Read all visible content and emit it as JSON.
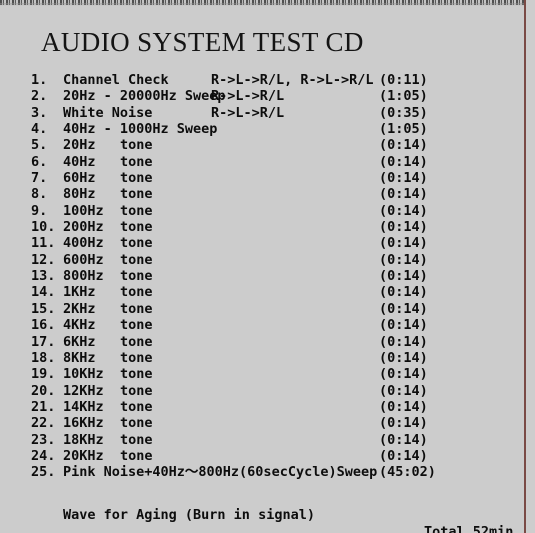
{
  "page": {
    "background_color": "#cccccc",
    "text_color": "#0d0d0d",
    "accent_rule_color": "#7a4a45"
  },
  "title": "AUDIO SYSTEM TEST CD",
  "tracklist": {
    "columns": [
      "number",
      "name",
      "detail",
      "duration"
    ],
    "tracks": [
      {
        "number": "1.",
        "name": "Channel Check",
        "detail": "R->L->R/L, R->L->R/L",
        "duration": "(0:11)"
      },
      {
        "number": "2.",
        "name": "20Hz - 20000Hz Sweep",
        "detail": "R->L->R/L",
        "duration": "(1:05)"
      },
      {
        "number": "3.",
        "name": "White Noise",
        "detail": "R->L->R/L",
        "duration": "(0:35)"
      },
      {
        "number": "4.",
        "name": "40Hz - 1000Hz Sweep",
        "detail": "",
        "duration": "(1:05)"
      },
      {
        "number": "5.",
        "name": "20Hz",
        "detail2": "tone",
        "detail": "",
        "duration": "(0:14)"
      },
      {
        "number": "6.",
        "name": "40Hz",
        "detail2": "tone",
        "detail": "",
        "duration": "(0:14)"
      },
      {
        "number": "7.",
        "name": "60Hz",
        "detail2": "tone",
        "detail": "",
        "duration": "(0:14)"
      },
      {
        "number": "8.",
        "name": "80Hz",
        "detail2": "tone",
        "detail": "",
        "duration": "(0:14)"
      },
      {
        "number": "9.",
        "name": "100Hz",
        "detail2": "tone",
        "detail": "",
        "duration": "(0:14)"
      },
      {
        "number": "10.",
        "name": "200Hz",
        "detail2": "tone",
        "detail": "",
        "duration": "(0:14)"
      },
      {
        "number": "11.",
        "name": "400Hz",
        "detail2": "tone",
        "detail": "",
        "duration": "(0:14)"
      },
      {
        "number": "12.",
        "name": "600Hz",
        "detail2": "tone",
        "detail": "",
        "duration": "(0:14)"
      },
      {
        "number": "13.",
        "name": "800Hz",
        "detail2": "tone",
        "detail": "",
        "duration": "(0:14)"
      },
      {
        "number": "14.",
        "name": "1KHz",
        "detail2": "tone",
        "detail": "",
        "duration": "(0:14)"
      },
      {
        "number": "15.",
        "name": "2KHz",
        "detail2": "tone",
        "detail": "",
        "duration": "(0:14)"
      },
      {
        "number": "16.",
        "name": "4KHz",
        "detail2": "tone",
        "detail": "",
        "duration": "(0:14)"
      },
      {
        "number": "17.",
        "name": "6KHz",
        "detail2": "tone",
        "detail": "",
        "duration": "(0:14)"
      },
      {
        "number": "18.",
        "name": "8KHz",
        "detail2": "tone",
        "detail": "",
        "duration": "(0:14)"
      },
      {
        "number": "19.",
        "name": "10KHz",
        "detail2": "tone",
        "detail": "",
        "duration": "(0:14)"
      },
      {
        "number": "20.",
        "name": "12KHz",
        "detail2": "tone",
        "detail": "",
        "duration": "(0:14)"
      },
      {
        "number": "21.",
        "name": "14KHz",
        "detail2": "tone",
        "detail": "",
        "duration": "(0:14)"
      },
      {
        "number": "22.",
        "name": "16KHz",
        "detail2": "tone",
        "detail": "",
        "duration": "(0:14)"
      },
      {
        "number": "23.",
        "name": "18KHz",
        "detail2": "tone",
        "detail": "",
        "duration": "(0:14)"
      },
      {
        "number": "24.",
        "name": "20KHz",
        "detail2": "tone",
        "detail": "",
        "duration": "(0:14)"
      },
      {
        "number": "25.",
        "name": "Pink Noise+40Hz〜800Hz(60secCycle)Sweep",
        "detail": "",
        "duration": "(45:02)"
      }
    ]
  },
  "footer": {
    "note": "Wave for Aging (Burn in signal)",
    "total": "Total 52min"
  }
}
